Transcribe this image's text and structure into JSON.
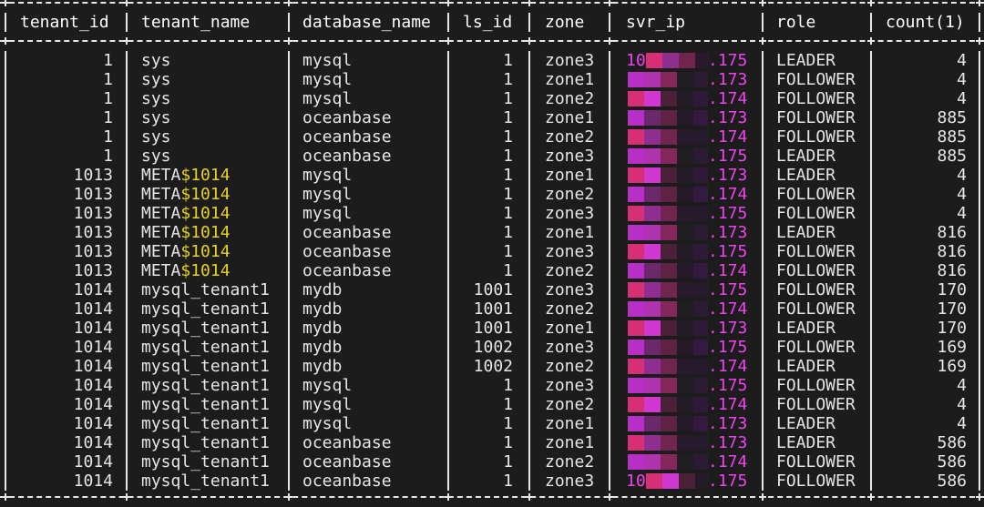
{
  "table": {
    "headers": [
      "tenant_id",
      "tenant_name",
      "database_name",
      "ls_id",
      "zone",
      "svr_ip",
      "role",
      "count(1)"
    ],
    "rows": [
      {
        "tenant_id": "1",
        "tenant_name": "sys",
        "name_suffix": "",
        "database_name": "mysql",
        "ls_id": "1",
        "zone": "zone3",
        "ip_prefix": "10",
        "ip_suffix": ".175",
        "role": "LEADER",
        "count": "4"
      },
      {
        "tenant_id": "1",
        "tenant_name": "sys",
        "name_suffix": "",
        "database_name": "mysql",
        "ls_id": "1",
        "zone": "zone1",
        "ip_prefix": "",
        "ip_suffix": ".173",
        "role": "FOLLOWER",
        "count": "4"
      },
      {
        "tenant_id": "1",
        "tenant_name": "sys",
        "name_suffix": "",
        "database_name": "mysql",
        "ls_id": "1",
        "zone": "zone2",
        "ip_prefix": "",
        "ip_suffix": ".174",
        "role": "FOLLOWER",
        "count": "4"
      },
      {
        "tenant_id": "1",
        "tenant_name": "sys",
        "name_suffix": "",
        "database_name": "oceanbase",
        "ls_id": "1",
        "zone": "zone1",
        "ip_prefix": "",
        "ip_suffix": ".173",
        "role": "FOLLOWER",
        "count": "885"
      },
      {
        "tenant_id": "1",
        "tenant_name": "sys",
        "name_suffix": "",
        "database_name": "oceanbase",
        "ls_id": "1",
        "zone": "zone2",
        "ip_prefix": "",
        "ip_suffix": ".174",
        "role": "FOLLOWER",
        "count": "885"
      },
      {
        "tenant_id": "1",
        "tenant_name": "sys",
        "name_suffix": "",
        "database_name": "oceanbase",
        "ls_id": "1",
        "zone": "zone3",
        "ip_prefix": "",
        "ip_suffix": ".175",
        "role": "LEADER",
        "count": "885"
      },
      {
        "tenant_id": "1013",
        "tenant_name": "META",
        "name_suffix": "$1014",
        "database_name": "mysql",
        "ls_id": "1",
        "zone": "zone1",
        "ip_prefix": "",
        "ip_suffix": ".173",
        "role": "LEADER",
        "count": "4"
      },
      {
        "tenant_id": "1013",
        "tenant_name": "META",
        "name_suffix": "$1014",
        "database_name": "mysql",
        "ls_id": "1",
        "zone": "zone2",
        "ip_prefix": "",
        "ip_suffix": ".174",
        "role": "FOLLOWER",
        "count": "4"
      },
      {
        "tenant_id": "1013",
        "tenant_name": "META",
        "name_suffix": "$1014",
        "database_name": "mysql",
        "ls_id": "1",
        "zone": "zone3",
        "ip_prefix": "",
        "ip_suffix": ".175",
        "role": "FOLLOWER",
        "count": "4"
      },
      {
        "tenant_id": "1013",
        "tenant_name": "META",
        "name_suffix": "$1014",
        "database_name": "oceanbase",
        "ls_id": "1",
        "zone": "zone1",
        "ip_prefix": "",
        "ip_suffix": ".173",
        "role": "LEADER",
        "count": "816"
      },
      {
        "tenant_id": "1013",
        "tenant_name": "META",
        "name_suffix": "$1014",
        "database_name": "oceanbase",
        "ls_id": "1",
        "zone": "zone3",
        "ip_prefix": "",
        "ip_suffix": ".175",
        "role": "FOLLOWER",
        "count": "816"
      },
      {
        "tenant_id": "1013",
        "tenant_name": "META",
        "name_suffix": "$1014",
        "database_name": "oceanbase",
        "ls_id": "1",
        "zone": "zone2",
        "ip_prefix": "",
        "ip_suffix": ".174",
        "role": "FOLLOWER",
        "count": "816"
      },
      {
        "tenant_id": "1014",
        "tenant_name": "mysql_tenant1",
        "name_suffix": "",
        "database_name": "mydb",
        "ls_id": "1001",
        "zone": "zone3",
        "ip_prefix": "",
        "ip_suffix": ".175",
        "role": "FOLLOWER",
        "count": "170"
      },
      {
        "tenant_id": "1014",
        "tenant_name": "mysql_tenant1",
        "name_suffix": "",
        "database_name": "mydb",
        "ls_id": "1001",
        "zone": "zone2",
        "ip_prefix": "",
        "ip_suffix": ".174",
        "role": "FOLLOWER",
        "count": "170"
      },
      {
        "tenant_id": "1014",
        "tenant_name": "mysql_tenant1",
        "name_suffix": "",
        "database_name": "mydb",
        "ls_id": "1001",
        "zone": "zone1",
        "ip_prefix": "",
        "ip_suffix": ".173",
        "role": "LEADER",
        "count": "170"
      },
      {
        "tenant_id": "1014",
        "tenant_name": "mysql_tenant1",
        "name_suffix": "",
        "database_name": "mydb",
        "ls_id": "1002",
        "zone": "zone3",
        "ip_prefix": "",
        "ip_suffix": ".175",
        "role": "FOLLOWER",
        "count": "169"
      },
      {
        "tenant_id": "1014",
        "tenant_name": "mysql_tenant1",
        "name_suffix": "",
        "database_name": "mydb",
        "ls_id": "1002",
        "zone": "zone2",
        "ip_prefix": "",
        "ip_suffix": ".174",
        "role": "LEADER",
        "count": "169"
      },
      {
        "tenant_id": "1014",
        "tenant_name": "mysql_tenant1",
        "name_suffix": "",
        "database_name": "mysql",
        "ls_id": "1",
        "zone": "zone3",
        "ip_prefix": "",
        "ip_suffix": ".175",
        "role": "FOLLOWER",
        "count": "4"
      },
      {
        "tenant_id": "1014",
        "tenant_name": "mysql_tenant1",
        "name_suffix": "",
        "database_name": "mysql",
        "ls_id": "1",
        "zone": "zone2",
        "ip_prefix": "",
        "ip_suffix": ".174",
        "role": "FOLLOWER",
        "count": "4"
      },
      {
        "tenant_id": "1014",
        "tenant_name": "mysql_tenant1",
        "name_suffix": "",
        "database_name": "mysql",
        "ls_id": "1",
        "zone": "zone1",
        "ip_prefix": "",
        "ip_suffix": ".173",
        "role": "LEADER",
        "count": "4"
      },
      {
        "tenant_id": "1014",
        "tenant_name": "mysql_tenant1",
        "name_suffix": "",
        "database_name": "oceanbase",
        "ls_id": "1",
        "zone": "zone1",
        "ip_prefix": "",
        "ip_suffix": ".173",
        "role": "LEADER",
        "count": "586"
      },
      {
        "tenant_id": "1014",
        "tenant_name": "mysql_tenant1",
        "name_suffix": "",
        "database_name": "oceanbase",
        "ls_id": "1",
        "zone": "zone2",
        "ip_prefix": "",
        "ip_suffix": ".174",
        "role": "FOLLOWER",
        "count": "586"
      },
      {
        "tenant_id": "1014",
        "tenant_name": "mysql_tenant1",
        "name_suffix": "",
        "database_name": "oceanbase",
        "ls_id": "1",
        "zone": "zone3",
        "ip_prefix": "10",
        "ip_suffix": ".175",
        "role": "FOLLOWER",
        "count": "586"
      }
    ]
  },
  "colors": {
    "background": "#1c1c1c",
    "text": "#e6e6e6",
    "highlight_yellow": "#e8d21f",
    "ip_magenta": "#f041f0",
    "redaction_palette": [
      "#e0307a",
      "#c030d0",
      "#5a2a8a",
      "#3a1a4a",
      "#2a1a2e",
      "#a02a6a",
      "#ff40ff"
    ]
  }
}
